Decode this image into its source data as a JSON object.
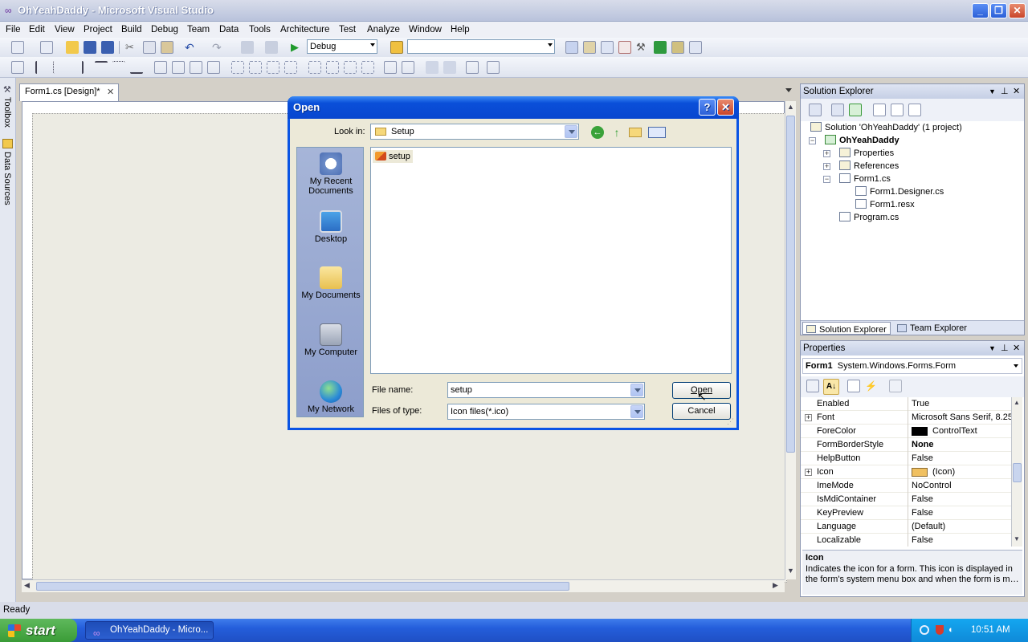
{
  "window": {
    "title": "OhYeahDaddy - Microsoft Visual Studio"
  },
  "menu": [
    "File",
    "Edit",
    "View",
    "Project",
    "Build",
    "Debug",
    "Team",
    "Data",
    "Tools",
    "Architecture",
    "Test",
    "Analyze",
    "Window",
    "Help"
  ],
  "toolbar": {
    "config": "Debug",
    "platform": ""
  },
  "side_tabs": {
    "toolbox": "Toolbox",
    "data_sources": "Data Sources"
  },
  "document": {
    "tab_label": "Form1.cs [Design]*"
  },
  "solution_explorer": {
    "title": "Solution Explorer",
    "items": [
      "Solution 'OhYeahDaddy' (1 project)",
      "OhYeahDaddy",
      "Properties",
      "References",
      "Form1.cs",
      "Form1.Designer.cs",
      "Form1.resx",
      "Program.cs"
    ],
    "bottom_tabs": [
      "Solution Explorer",
      "Team Explorer"
    ]
  },
  "properties": {
    "title": "Properties",
    "object_name": "Form1",
    "object_type": "System.Windows.Forms.Form",
    "rows": [
      {
        "name": "Enabled",
        "value": "True"
      },
      {
        "name": "Font",
        "value": "Microsoft Sans Serif, 8.25"
      },
      {
        "name": "ForeColor",
        "value": "ControlText"
      },
      {
        "name": "FormBorderStyle",
        "value": "None"
      },
      {
        "name": "HelpButton",
        "value": "False"
      },
      {
        "name": "Icon",
        "value": "(Icon)"
      },
      {
        "name": "ImeMode",
        "value": "NoControl"
      },
      {
        "name": "IsMdiContainer",
        "value": "False"
      },
      {
        "name": "KeyPreview",
        "value": "False"
      },
      {
        "name": "Language",
        "value": "(Default)"
      },
      {
        "name": "Localizable",
        "value": "False"
      }
    ],
    "description_title": "Icon",
    "description_text": "Indicates the icon for a form. This icon is displayed in the form's system menu box and when the form is m…"
  },
  "status": {
    "text": "Ready"
  },
  "taskbar": {
    "start": "start",
    "app": "OhYeahDaddy - Micro...",
    "clock": "10:51 AM"
  },
  "dialog": {
    "title": "Open",
    "look_in_label": "Look in:",
    "look_in_value": "Setup",
    "places": [
      "My Recent Documents",
      "Desktop",
      "My Documents",
      "My Computer",
      "My Network"
    ],
    "files": [
      "setup"
    ],
    "file_name_label": "File name:",
    "file_name_value": "setup",
    "file_type_label": "Files of type:",
    "file_type_value": "Icon files(*.ico)",
    "open_button": "Open",
    "cancel_button": "Cancel"
  }
}
